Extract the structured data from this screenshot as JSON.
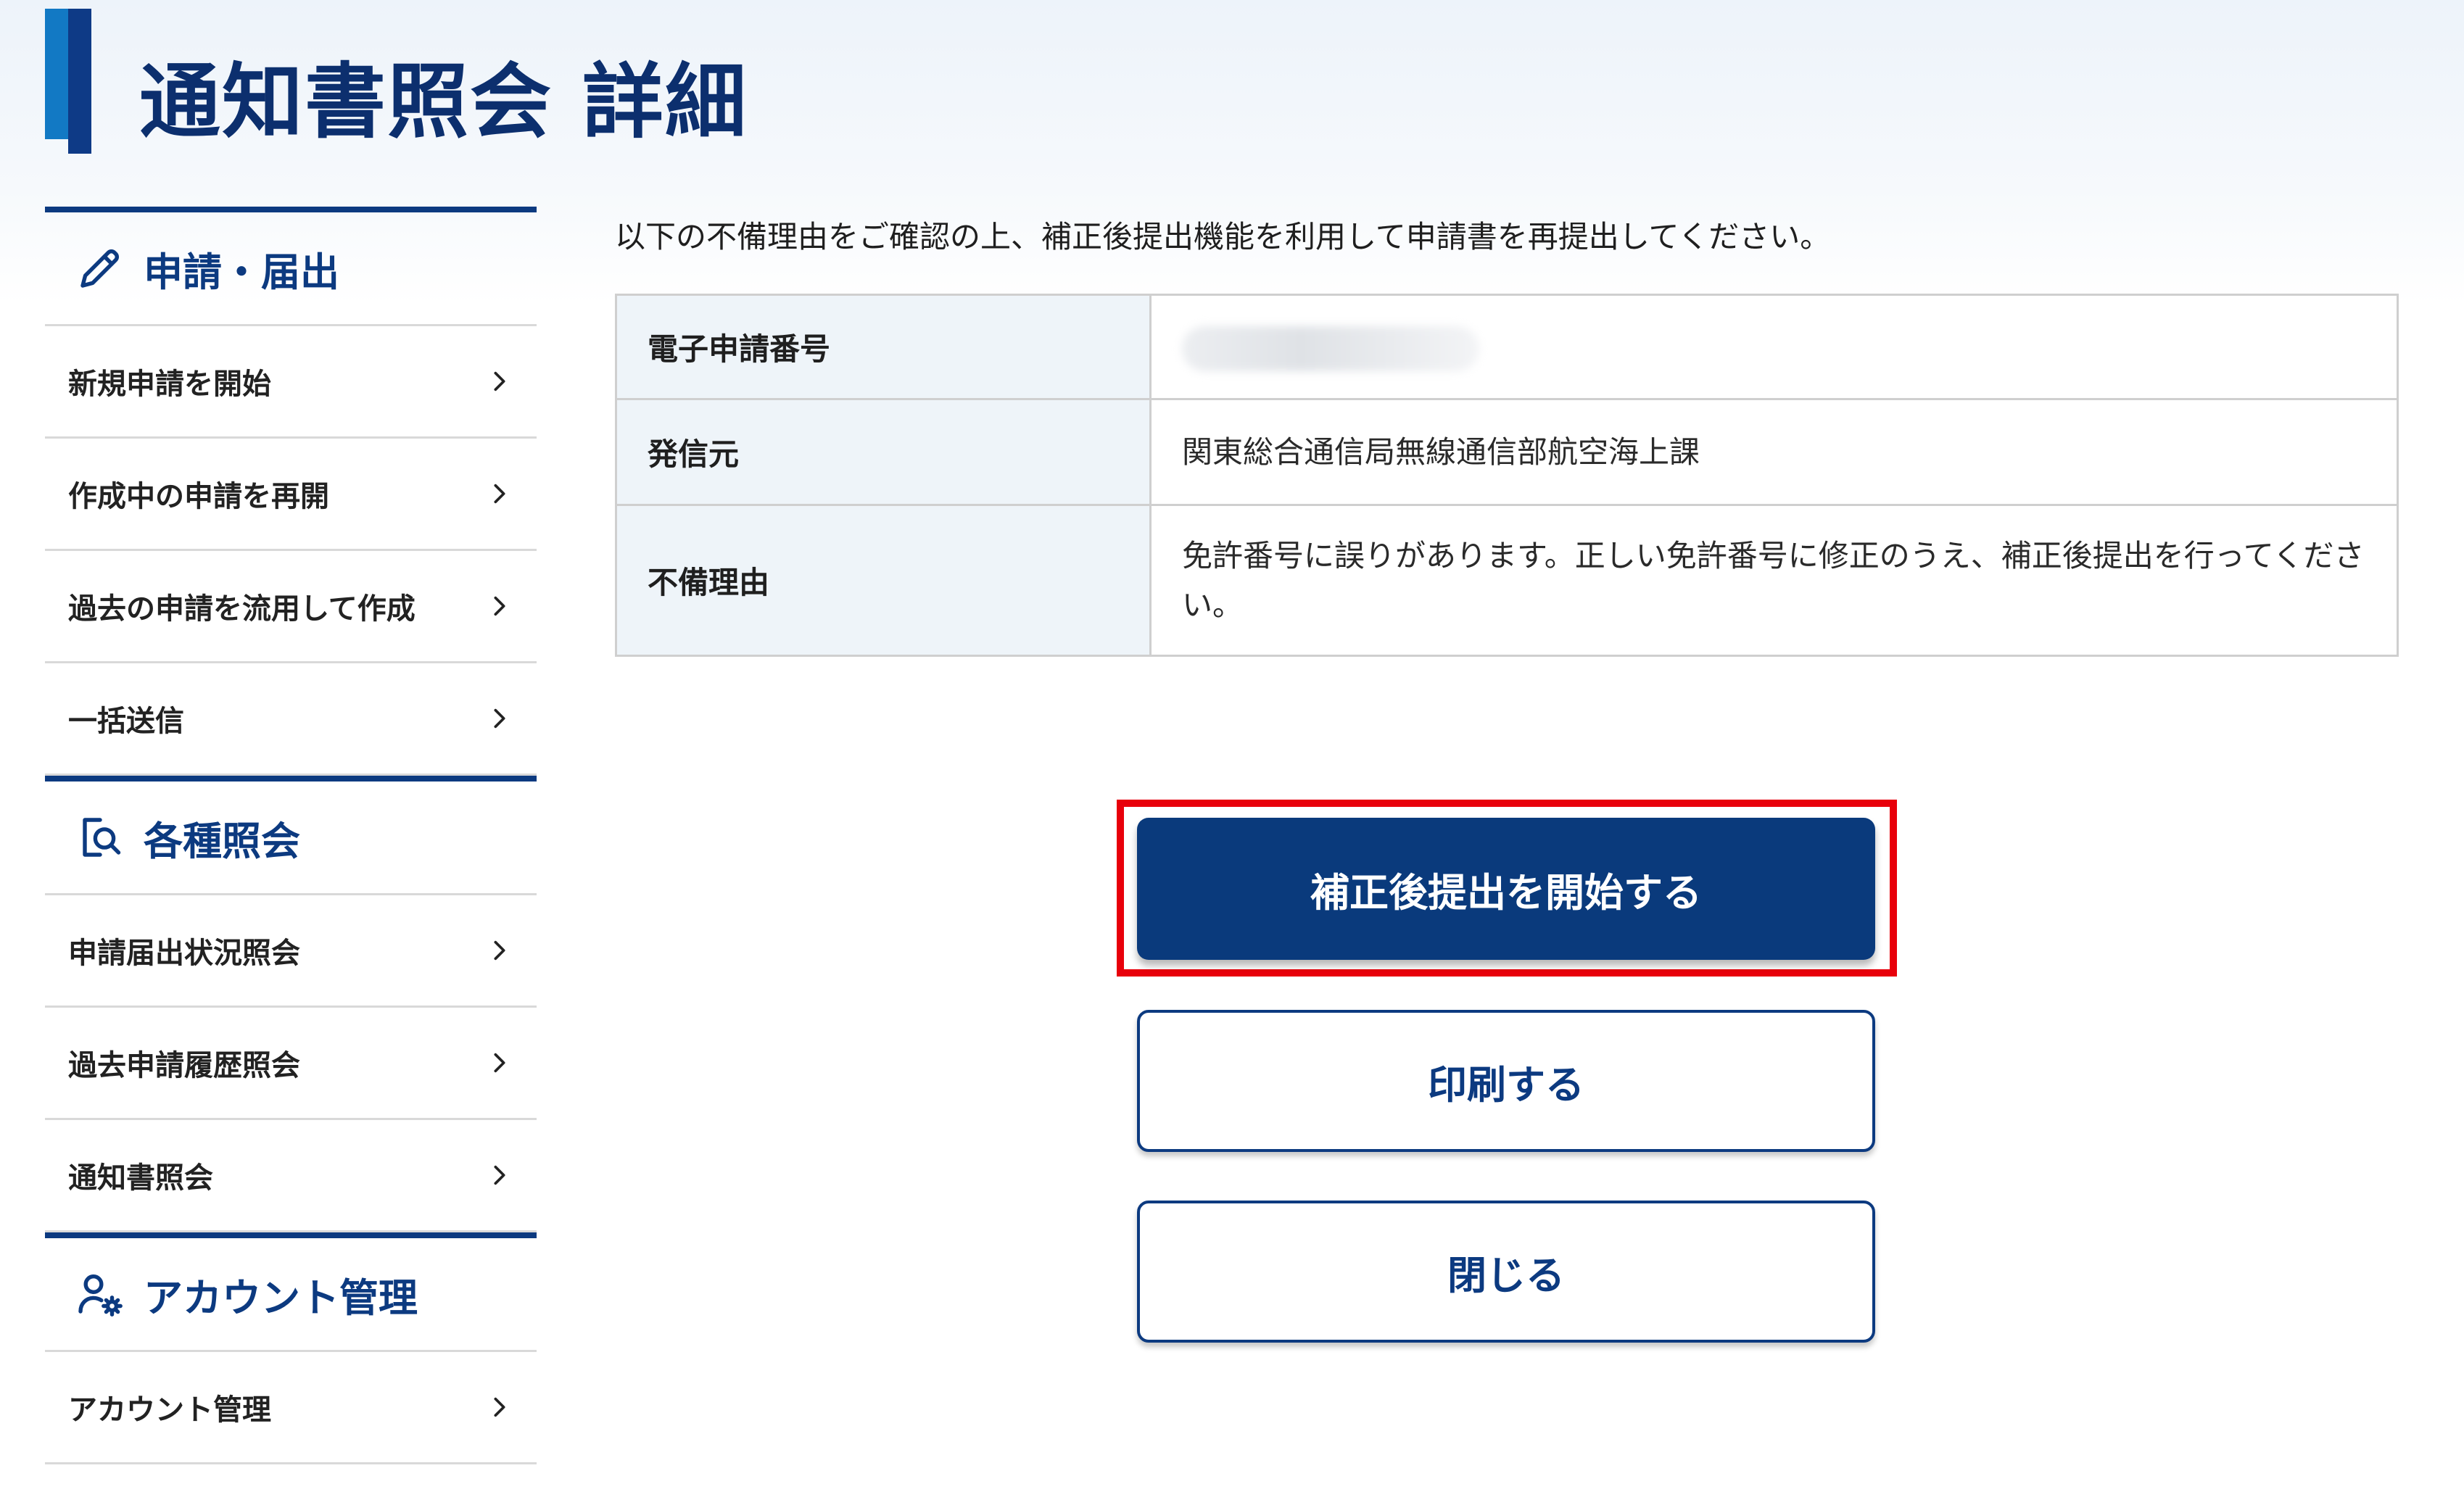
{
  "page": {
    "title": "通知書照会 詳細"
  },
  "sidebar": {
    "sections": [
      {
        "label": "申請・届出",
        "icon": "pencil-icon",
        "items": [
          {
            "label": "新規申請を開始"
          },
          {
            "label": "作成中の申請を再開"
          },
          {
            "label": "過去の申請を流用して作成"
          },
          {
            "label": "一括送信"
          }
        ]
      },
      {
        "label": "各種照会",
        "icon": "document-search-icon",
        "items": [
          {
            "label": "申請届出状況照会"
          },
          {
            "label": "過去申請履歴照会"
          },
          {
            "label": "通知書照会"
          }
        ]
      },
      {
        "label": "アカウント管理",
        "icon": "user-gear-icon",
        "items": [
          {
            "label": "アカウント管理"
          }
        ]
      }
    ]
  },
  "main": {
    "intro": "以下の不備理由をご確認の上、補正後提出機能を利用して申請書を再提出してください。",
    "table": {
      "rows": [
        {
          "label": "電子申請番号",
          "value": ""
        },
        {
          "label": "発信元",
          "value": "関東総合通信局無線通信部航空海上課"
        },
        {
          "label": "不備理由",
          "value": "免許番号に誤りがあります。正しい免許番号に修正のうえ、補正後提出を行ってください。"
        }
      ]
    },
    "buttons": {
      "start_correction": "補正後提出を開始する",
      "print": "印刷する",
      "close": "閉じる"
    }
  },
  "colors": {
    "brand_dark": "#0c3a80",
    "brand_light": "#1279c4",
    "highlight": "#e8000b"
  }
}
